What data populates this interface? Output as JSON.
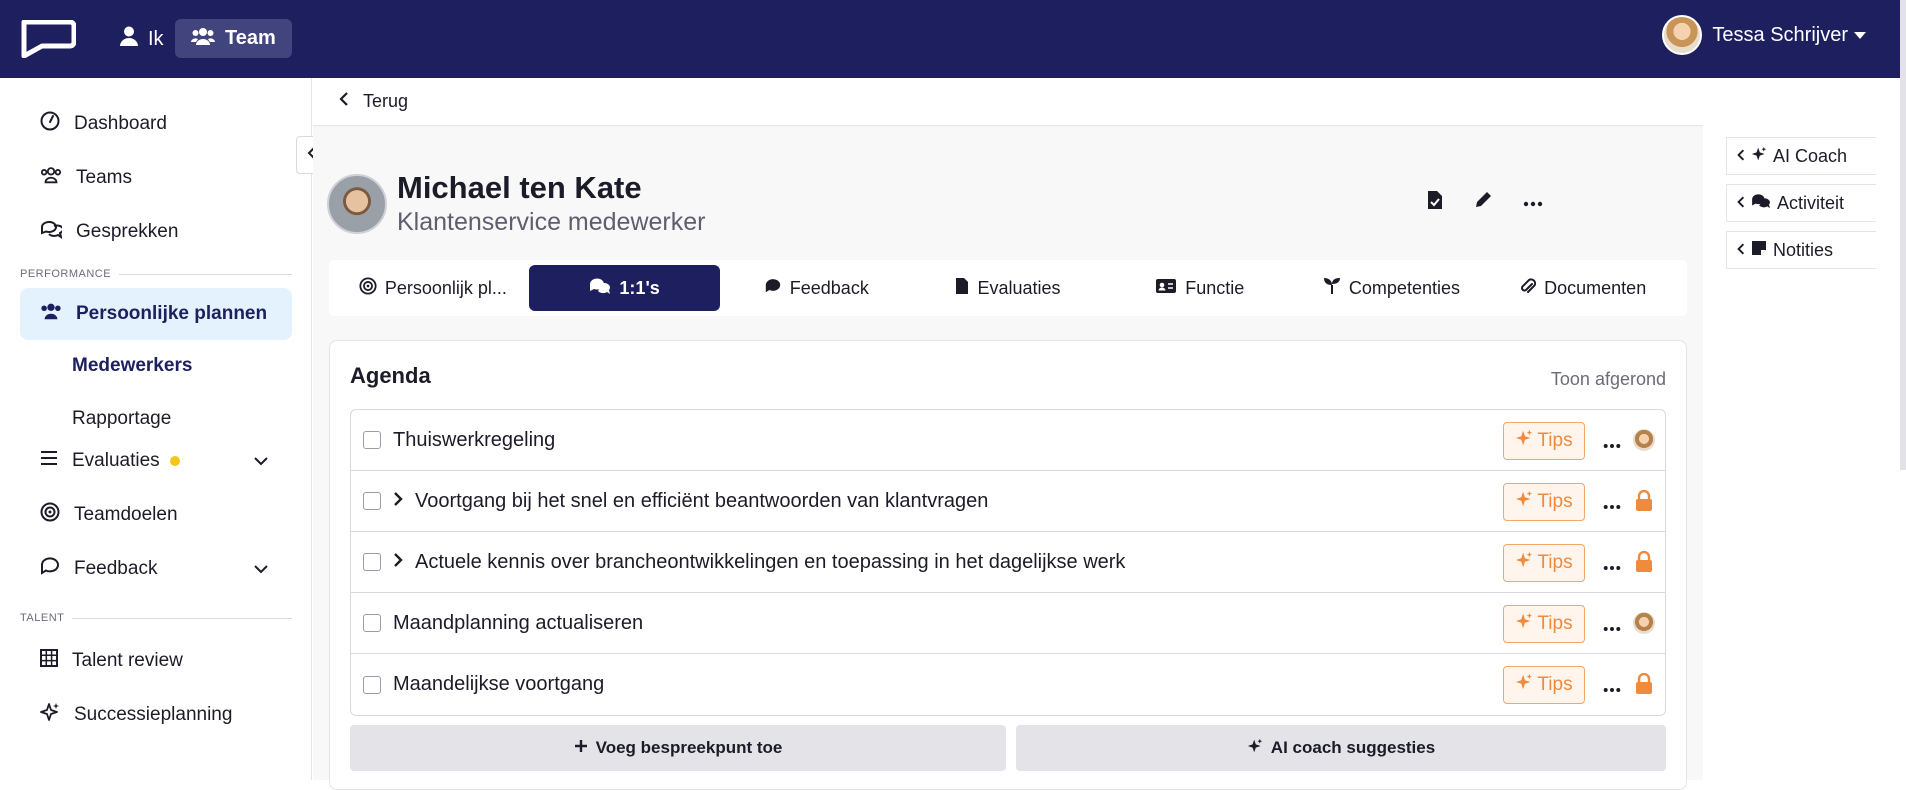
{
  "topbar": {
    "nav_ik": "Ik",
    "nav_team": "Team",
    "user_name": "Tessa Schrijver"
  },
  "sidebar": {
    "items": [
      {
        "label": "Dashboard",
        "icon": "speedometer-icon"
      },
      {
        "label": "Teams",
        "icon": "users-icon"
      },
      {
        "label": "Gesprekken",
        "icon": "chat-bubbles-icon"
      }
    ],
    "section_performance": "PERFORMANCE",
    "persoonlijke_plannen": "Persoonlijke plannen",
    "sub_medewerkers": "Medewerkers",
    "sub_rapportage": "Rapportage",
    "evaluaties": "Evaluaties",
    "teamdoelen": "Teamdoelen",
    "feedback": "Feedback",
    "section_talent": "TALENT",
    "talent_review": "Talent review",
    "successieplanning": "Successieplanning"
  },
  "main": {
    "back_label": "Terug",
    "person_name": "Michael ten Kate",
    "person_role": "Klantenservice medewerker",
    "tabs": [
      {
        "label": "Persoonlijk pl...",
        "icon": "target-icon"
      },
      {
        "label": "1:1's",
        "icon": "chat-bubbles-icon"
      },
      {
        "label": "Feedback",
        "icon": "chat-icon"
      },
      {
        "label": "Evaluaties",
        "icon": "document-icon"
      },
      {
        "label": "Functie",
        "icon": "id-card-icon"
      },
      {
        "label": "Competenties",
        "icon": "seedling-icon"
      },
      {
        "label": "Documenten",
        "icon": "paperclip-icon"
      }
    ],
    "agenda": {
      "title": "Agenda",
      "toon_afgerond": "Toon afgerond",
      "tips_label": "Tips",
      "items": [
        {
          "title": "Thuiswerkregeling",
          "expandable": false,
          "right": "avatar"
        },
        {
          "title": "Voortgang bij het snel en efficiënt beantwoorden van klantvragen",
          "expandable": true,
          "right": "lock"
        },
        {
          "title": "Actuele kennis over brancheontwikkelingen en toepassing in het dagelijkse werk",
          "expandable": true,
          "right": "lock"
        },
        {
          "title": "Maandplanning actualiseren",
          "expandable": false,
          "right": "avatar"
        },
        {
          "title": "Maandelijkse voortgang",
          "expandable": false,
          "right": "lock"
        }
      ],
      "add_button": "Voeg bespreekpunt toe",
      "ai_button": "AI coach suggesties"
    }
  },
  "right_panels": {
    "ai_coach": "AI Coach",
    "activiteit": "Activiteit",
    "notities": "Notities"
  },
  "colors": {
    "navy": "#1e1f5e",
    "accent_orange": "#f08a3c",
    "active_bg": "#e3f2fd"
  }
}
